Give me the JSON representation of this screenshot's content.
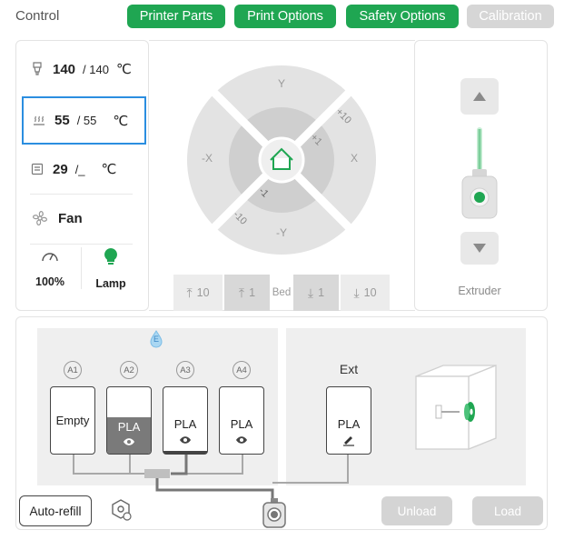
{
  "header": {
    "title": "Control",
    "tabs": [
      {
        "label": "Printer Parts",
        "active": true
      },
      {
        "label": "Print Options",
        "active": true
      },
      {
        "label": "Safety Options",
        "active": true
      },
      {
        "label": "Calibration",
        "active": false
      }
    ]
  },
  "temperatures": {
    "nozzle": {
      "current": "140",
      "target": "/ 140",
      "unit": "℃"
    },
    "bed": {
      "current": "55",
      "target": "/ 55",
      "unit": "℃"
    },
    "chamber": {
      "current": "29",
      "target": "/_",
      "unit": "℃"
    }
  },
  "fan": {
    "label": "Fan"
  },
  "speed": {
    "value": "100%"
  },
  "lamp": {
    "label": "Lamp"
  },
  "jog": {
    "labels": {
      "y_plus": "Y",
      "y_minus": "-Y",
      "x_plus": "X",
      "x_minus": "-X",
      "plus10": "+10",
      "plus1": "+1",
      "minus1": "-1",
      "minus10": "-10"
    }
  },
  "bed_controls": {
    "up10": "10",
    "up1": "1",
    "label": "Bed",
    "down1": "1",
    "down10": "10"
  },
  "extruder": {
    "label": "Extruder"
  },
  "ams": {
    "badge": "E",
    "slots": [
      {
        "id": "A1",
        "material": "Empty",
        "selected": false
      },
      {
        "id": "A2",
        "material": "PLA",
        "selected": true
      },
      {
        "id": "A3",
        "material": "PLA",
        "selected": false
      },
      {
        "id": "A4",
        "material": "PLA",
        "selected": false
      }
    ],
    "ext": {
      "label": "Ext",
      "material": "PLA"
    }
  },
  "footer": {
    "auto_refill": "Auto-refill",
    "unload": "Unload",
    "load": "Load"
  },
  "colors": {
    "accent": "#1fa652",
    "selected_border": "#2b8ee0",
    "disabled": "#d4d4d4"
  }
}
